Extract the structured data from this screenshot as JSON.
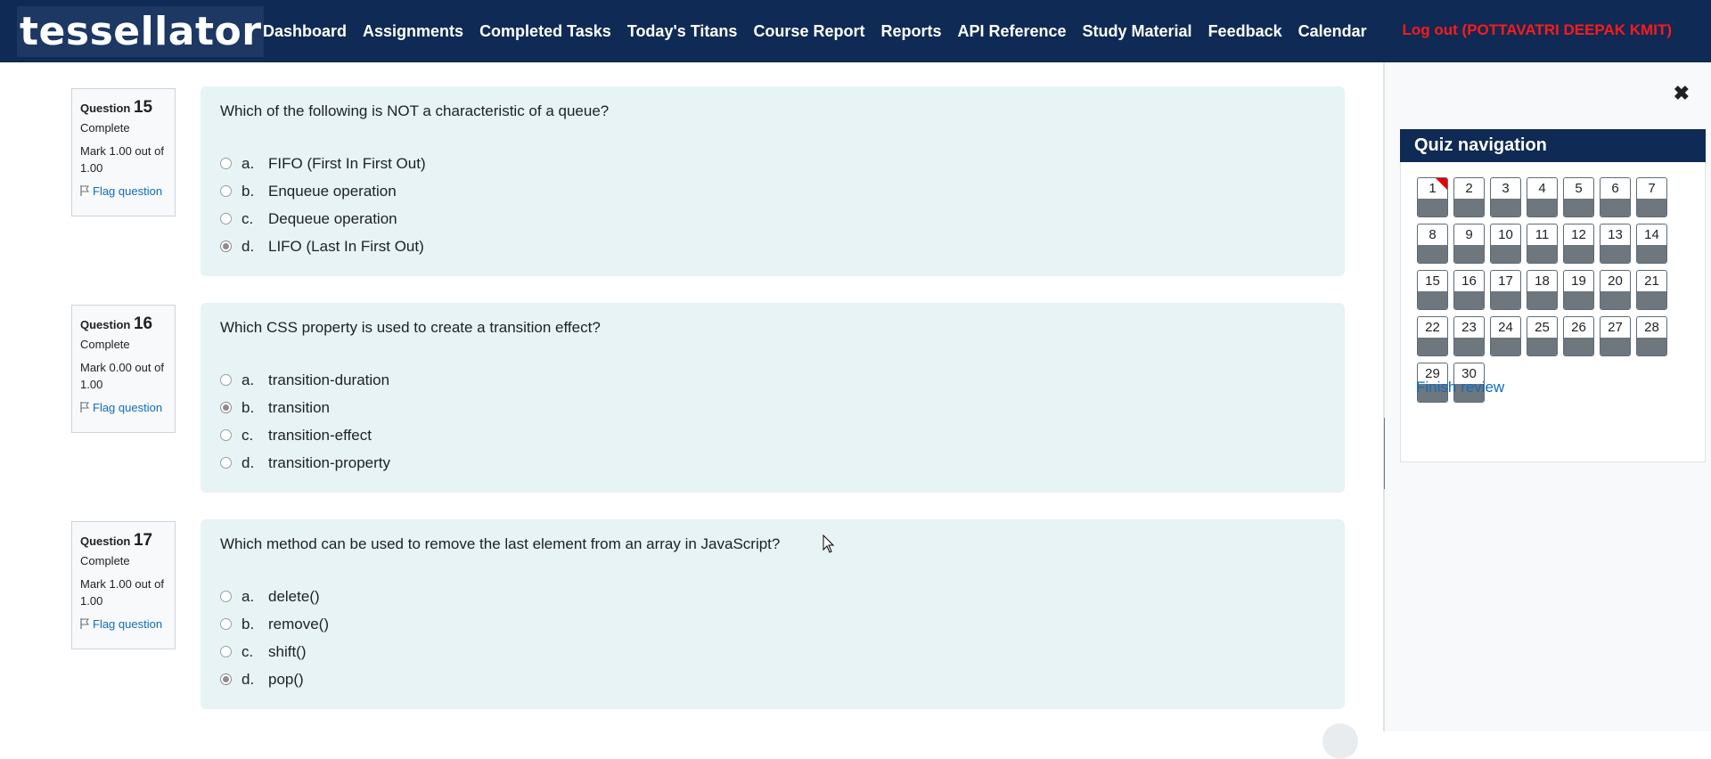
{
  "brand": "tessellator",
  "nav": [
    "Dashboard",
    "Assignments",
    "Completed Tasks",
    "Today's Titans",
    "Course Report",
    "Reports",
    "API Reference",
    "Study Material",
    "Feedback",
    "Calendar"
  ],
  "logout": "Log out (POTTAVATRI DEEPAK KMIT)",
  "questions": [
    {
      "label": "Question",
      "number": "15",
      "state": "Complete",
      "grade": "Mark 1.00 out of 1.00",
      "flag": "Flag question",
      "text": "Which of the following is NOT a characteristic of a queue?",
      "answers": [
        {
          "letter": "a.",
          "text": "FIFO (First In First Out)"
        },
        {
          "letter": "b.",
          "text": "Enqueue operation"
        },
        {
          "letter": "c.",
          "text": "Dequeue operation"
        },
        {
          "letter": "d.",
          "text": "LIFO (Last In First Out)"
        }
      ],
      "selected": "d."
    },
    {
      "label": "Question",
      "number": "16",
      "state": "Complete",
      "grade": "Mark 0.00 out of 1.00",
      "flag": "Flag question",
      "text": "Which CSS property is used to create a transition effect?",
      "answers": [
        {
          "letter": "a.",
          "text": "transition-duration"
        },
        {
          "letter": "b.",
          "text": "transition"
        },
        {
          "letter": "c.",
          "text": "transition-effect"
        },
        {
          "letter": "d.",
          "text": "transition-property"
        }
      ],
      "selected": "b."
    },
    {
      "label": "Question",
      "number": "17",
      "state": "Complete",
      "grade": "Mark 1.00 out of 1.00",
      "flag": "Flag question",
      "text": "Which method can be used to remove the last element from an array in JavaScript?",
      "answers": [
        {
          "letter": "a.",
          "text": "delete()"
        },
        {
          "letter": "b.",
          "text": "remove()"
        },
        {
          "letter": "c.",
          "text": "shift()"
        },
        {
          "letter": "d.",
          "text": "pop()"
        }
      ],
      "selected": "d."
    }
  ],
  "quiz_nav": {
    "title": "Quiz navigation",
    "close_icon": "close-icon",
    "buttons": [
      "1",
      "2",
      "3",
      "4",
      "5",
      "6",
      "7",
      "8",
      "9",
      "10",
      "11",
      "12",
      "13",
      "14",
      "15",
      "16",
      "17",
      "18",
      "19",
      "20",
      "21",
      "22",
      "23",
      "24",
      "25",
      "26",
      "27",
      "28",
      "29",
      "30"
    ],
    "flagged": [
      "1"
    ],
    "finish": "Finish review"
  },
  "colors": {
    "topbar": "#0f2a54",
    "formulation_bg": "#e7f3f5",
    "logout": "#ff1a1a",
    "link": "#0f6cbf",
    "flag_corner": "#e40000"
  }
}
